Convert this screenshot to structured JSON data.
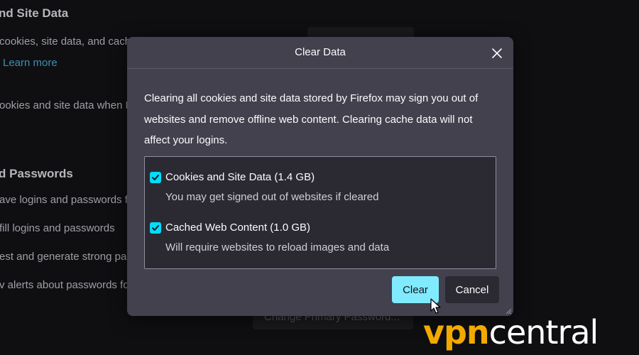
{
  "background": {
    "section1_heading": "nd Site Data",
    "line1": "cookies, site data, and cache",
    "learn_more": "Learn more",
    "line2": "ookies and site data when F",
    "section2_heading": "d Passwords",
    "line3": "ave logins and passwords fo",
    "line4": "fill logins and passwords",
    "line5": "est and generate strong pa",
    "line6": "v alerts about passwords for",
    "change_primary_password": "Change Primary Password..."
  },
  "dialog": {
    "title": "Clear Data",
    "description": "Clearing all cookies and site data stored by Firefox may sign you out of websites and remove offline web content. Clearing cache data will not affect your logins.",
    "options": [
      {
        "label": "Cookies and Site Data (1.4 GB)",
        "sublabel": "You may get signed out of websites if cleared",
        "checked": true
      },
      {
        "label": "Cached Web Content (1.0 GB)",
        "sublabel": "Will require websites to reload images and data",
        "checked": true
      }
    ],
    "clear_label": "Clear",
    "cancel_label": "Cancel"
  },
  "watermark": {
    "brand_vpn": "vpn",
    "brand_central": "central"
  },
  "colors": {
    "accent": "#00ddff",
    "button_primary": "#80ebff",
    "dialog_bg": "#42414d",
    "brand": "#f2a900"
  },
  "icons": {
    "close": "close-icon",
    "checkbox": "checkmark-icon",
    "cursor": "mouse-pointer-icon"
  }
}
